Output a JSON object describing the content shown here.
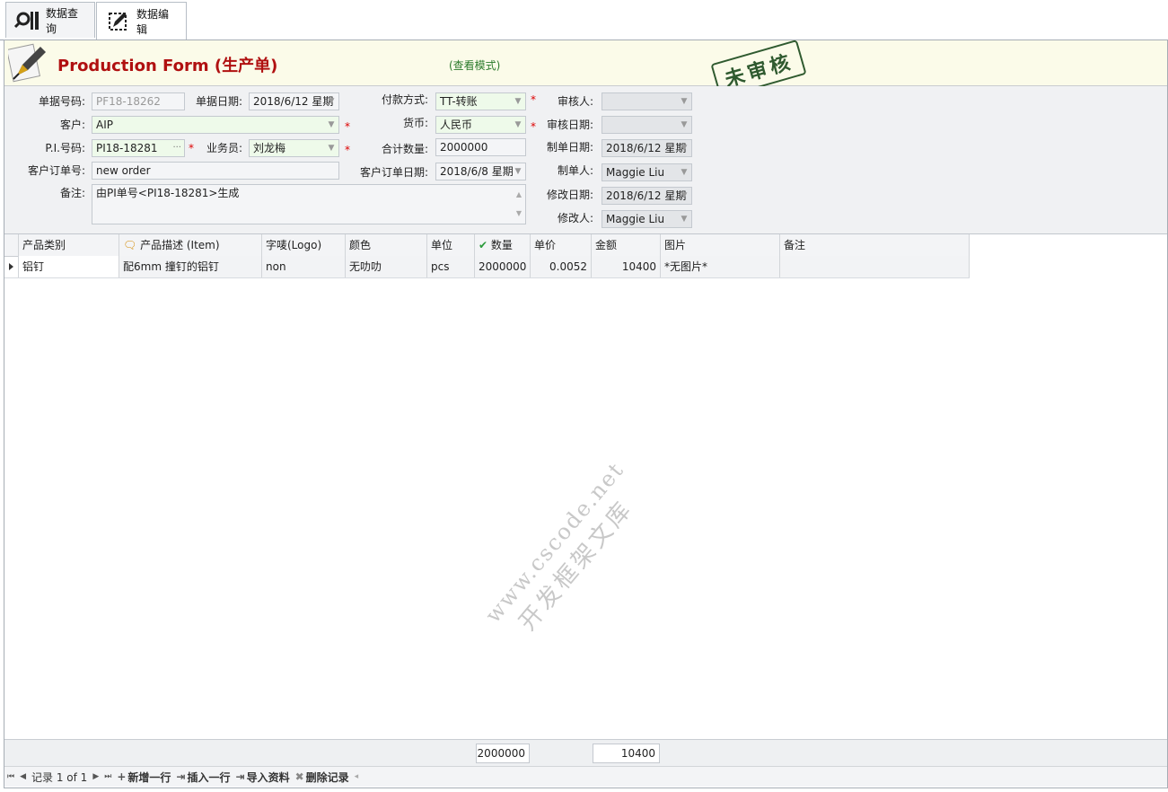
{
  "tabs": [
    {
      "label": "数据查询",
      "icon": "search-icon"
    },
    {
      "label": "数据编辑",
      "icon": "edit-icon"
    }
  ],
  "header": {
    "title": "Production Form (生产单)",
    "mode": "(查看模式)",
    "stamp": "未审核"
  },
  "form": {
    "doc_no_label": "单据号码:",
    "doc_no": "PF18-18262",
    "doc_date_label": "单据日期:",
    "doc_date": "2018/6/12 星期",
    "payment_label": "付款方式:",
    "payment": "TT-转账",
    "approver_label": "审核人:",
    "approver": "",
    "customer_label": "客户:",
    "customer": "AIP",
    "currency_label": "货币:",
    "currency": "人民币",
    "approve_date_label": "审核日期:",
    "approve_date": "",
    "pi_label": "P.I.号码:",
    "pi": "PI18-18281",
    "sales_label": "业务员:",
    "sales": "刘龙梅",
    "total_qty_label": "合计数量:",
    "total_qty": "2000000",
    "create_date_label": "制单日期:",
    "create_date": "2018/6/12 星期",
    "cust_order_label": "客户订单号:",
    "cust_order": "new order",
    "cust_order_date_label": "客户订单日期:",
    "cust_order_date": "2018/6/8 星期",
    "creator_label": "制单人:",
    "creator": "Maggie Liu",
    "remark_label": "备注:",
    "remark": "由PI单号<PI18-18281>生成",
    "modify_date_label": "修改日期:",
    "modify_date": "2018/6/12 星期",
    "modifier_label": "修改人:",
    "modifier": "Maggie Liu",
    "required_mark": "*"
  },
  "grid": {
    "columns": [
      "产品类别",
      "产品描述 (Item)",
      "字唛(Logo)",
      "颜色",
      "单位",
      "数量",
      "单价",
      "金额",
      "图片",
      "备注"
    ],
    "rows": [
      [
        "铝钉",
        "配6mm 撞钉的铝钉",
        "non",
        "无叻叻",
        "pcs",
        "2000000",
        "0.0052",
        "10400",
        "*无图片*",
        ""
      ]
    ]
  },
  "watermark": {
    "line1": "www.cscode.net",
    "line2": "开发框架文库"
  },
  "totals": {
    "qty": "2000000",
    "amount": "10400"
  },
  "navbar": {
    "record": "记录 1 of 1",
    "add_row": "新增一行",
    "insert_row": "插入一行",
    "import": "导入资料",
    "delete": "删除记录"
  },
  "colors": {
    "title": "#b01010",
    "mode": "#2a7a2a",
    "stamp": "#2f5a2f",
    "required": "#dd0000"
  }
}
